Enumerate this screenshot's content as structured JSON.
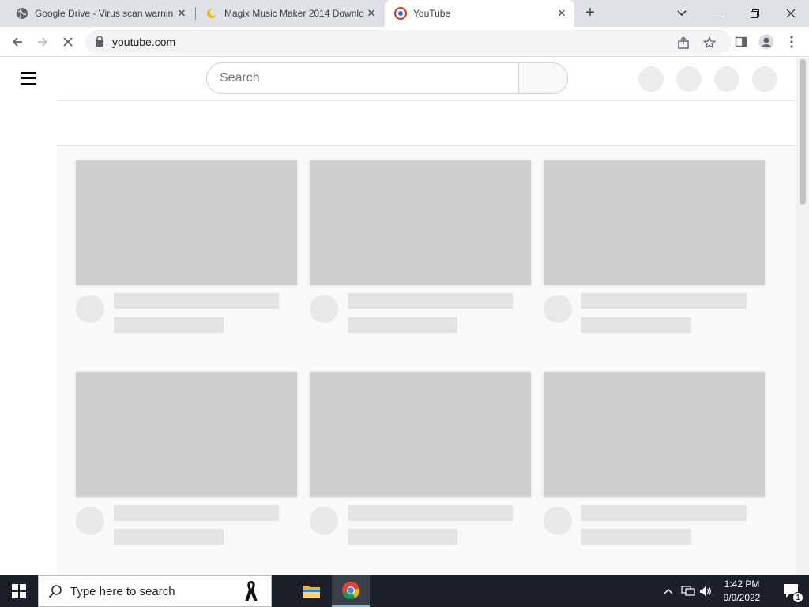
{
  "browser": {
    "tabs": [
      {
        "title": "Google Drive - Virus scan warnin",
        "icon": "globe-icon",
        "active": false
      },
      {
        "title": "Magix Music Maker 2014 Downlo",
        "icon": "moon-favicon-icon",
        "active": false
      },
      {
        "title": "YouTube",
        "icon": "youtube-favicon-icon",
        "active": true
      }
    ],
    "url": "youtube.com",
    "loading": true
  },
  "youtube": {
    "search_placeholder": "Search",
    "state": "loading-skeleton",
    "skeleton_cards": 6
  },
  "taskbar": {
    "search_placeholder": "Type here to search",
    "time": "1:42 PM",
    "date": "9/9/2022",
    "notification_count": "1"
  },
  "colors": {
    "tabstrip_bg": "#dee1e6",
    "taskbar_bg": "#1b1f2a",
    "skeleton_thumb": "#cfcfcf",
    "skeleton_line": "#e3e3e3"
  }
}
